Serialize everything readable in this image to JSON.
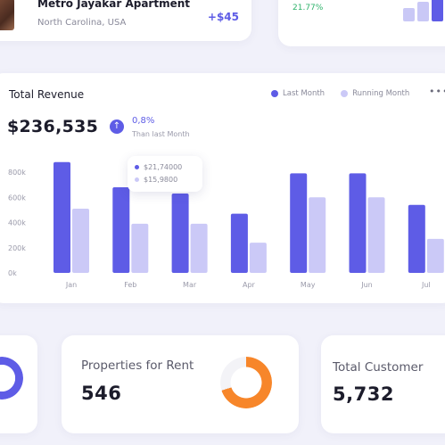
{
  "apartment": {
    "name": "Metro Jayakar Apartment",
    "location": "North Carolina, USA",
    "amount": "+$45"
  },
  "growth": {
    "percent": "21.77%",
    "mini_bars": [
      0.5,
      0.72,
      1.0
    ]
  },
  "revenue": {
    "title": "Total Revenue",
    "total": "$236,535",
    "change": "0,8%",
    "change_label": "Than last Month",
    "more": "•••",
    "legend": [
      {
        "name": "Last Month",
        "color": "#5e5ce6"
      },
      {
        "name": "Running Month",
        "color": "#cbc9f7"
      }
    ],
    "tooltip": [
      {
        "value": "$21,74000",
        "color": "#5e5ce6"
      },
      {
        "value": "$15,9800",
        "color": "#cbc9f7"
      }
    ]
  },
  "chart_data": {
    "type": "bar",
    "categories": [
      "Jan",
      "Feb",
      "Mar",
      "Apr",
      "May",
      "Jun",
      "Jul"
    ],
    "series": [
      {
        "name": "Last Month",
        "values": [
          880,
          680,
          630,
          470,
          790,
          790,
          540
        ]
      },
      {
        "name": "Running Month",
        "values": [
          510,
          390,
          390,
          240,
          600,
          600,
          270
        ]
      }
    ],
    "yticks": [
      "800k",
      "600k",
      "400k",
      "200k",
      "0k"
    ],
    "ytick_values": [
      800,
      600,
      400,
      200,
      0
    ],
    "ylim": [
      0,
      900
    ],
    "colors": {
      "last": "#5e5ce6",
      "running": "#cbc9f7"
    },
    "grid": false,
    "legend_position": "top-right"
  },
  "properties": {
    "label": "Properties for Rent",
    "value": "546",
    "donut_color": "#f7862a",
    "donut_fraction": 0.7
  },
  "customers": {
    "label": "Total Customer",
    "value": "5,732"
  },
  "donut_left": {
    "color": "#5e5ce6"
  }
}
